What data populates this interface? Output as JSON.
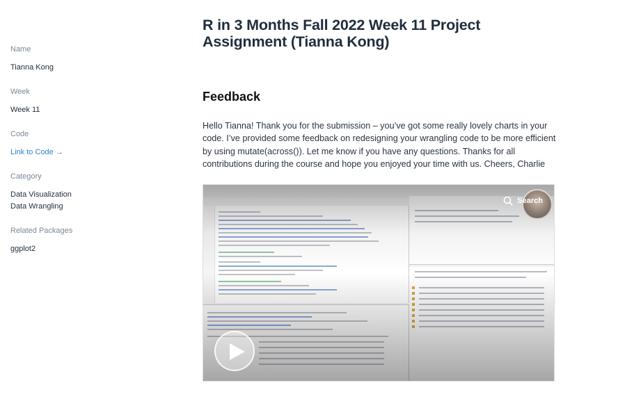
{
  "sidebar": {
    "name": {
      "label": "Name",
      "value": "Tianna Kong"
    },
    "week": {
      "label": "Week",
      "value": "Week 11"
    },
    "code": {
      "label": "Code",
      "link": "Link to Code →"
    },
    "category": {
      "label": "Category",
      "values": [
        "Data Visualization",
        "Data Wrangling"
      ]
    },
    "related": {
      "label": "Related Packages",
      "value": "ggplot2"
    }
  },
  "main": {
    "title": "R in 3 Months Fall 2022 Week 11 Project Assignment (Tianna Kong)",
    "section_heading": "Feedback",
    "feedback_text": "Hello Tianna! Thank you for the submission – you’ve got some really lovely charts in your code. I’ve provided some feedback on redesigning your wrangling code to be more efficient by using mutate(across()). Let me know if you have any questions. Thanks for all contributions during the course and hope you enjoyed your time with us. Cheers, Charlie"
  },
  "video": {
    "search_label": "Search",
    "icons": [
      "search-icon",
      "play-icon"
    ]
  }
}
